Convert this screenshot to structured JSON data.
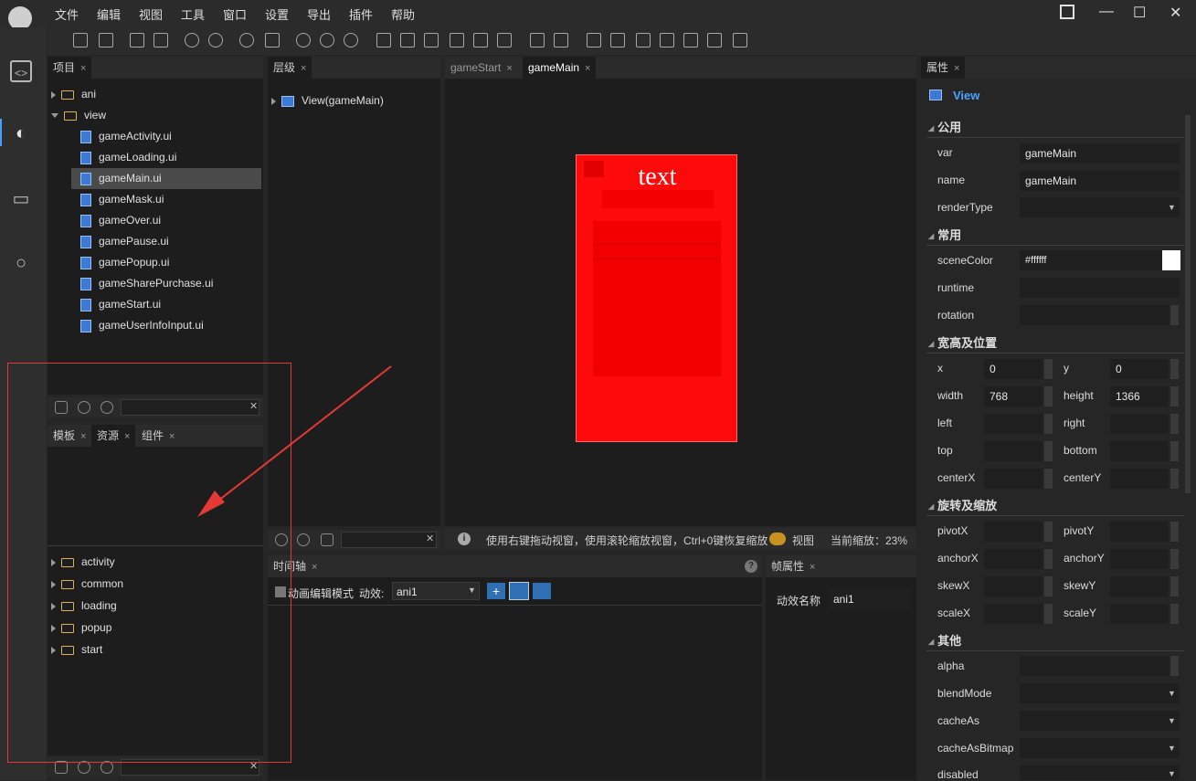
{
  "menu": [
    "文件",
    "编辑",
    "视图",
    "工具",
    "窗口",
    "设置",
    "导出",
    "插件",
    "帮助"
  ],
  "window_controls": {
    "gift": "gift-icon",
    "minimize": "—",
    "maximize": "☐",
    "close": "✕"
  },
  "project_panel": {
    "tab": "项目",
    "tree": [
      {
        "label": "ani",
        "type": "folder",
        "expanded": false
      },
      {
        "label": "view",
        "type": "folder",
        "expanded": true
      },
      {
        "label": "gameActivity.ui",
        "type": "file"
      },
      {
        "label": "gameLoading.ui",
        "type": "file"
      },
      {
        "label": "gameMain.ui",
        "type": "file",
        "selected": true
      },
      {
        "label": "gameMask.ui",
        "type": "file"
      },
      {
        "label": "gameOver.ui",
        "type": "file"
      },
      {
        "label": "gamePause.ui",
        "type": "file"
      },
      {
        "label": "gamePopup.ui",
        "type": "file"
      },
      {
        "label": "gameSharePurchase.ui",
        "type": "file"
      },
      {
        "label": "gameStart.ui",
        "type": "file"
      },
      {
        "label": "gameUserInfoInput.ui",
        "type": "file"
      }
    ]
  },
  "resource_panel": {
    "tabs": [
      "模板",
      "资源",
      "组件"
    ],
    "folders": [
      "activity",
      "common",
      "loading",
      "popup",
      "start"
    ]
  },
  "hierarchy_panel": {
    "tab": "层级",
    "root": "View(gameMain)"
  },
  "editor": {
    "tabs": [
      "gameStart",
      "gameMain"
    ],
    "active_tab": "gameMain",
    "canvas_text": "text",
    "canvas_color": "#ff0000",
    "status_hint": "使用右键拖动视窗，使用滚轮缩放视窗，Ctrl+0键恢复缩放",
    "view_label": "视图",
    "zoom_label": "当前缩放：23%"
  },
  "timeline": {
    "tab": "时间轴",
    "mode_label": "动画编辑模式",
    "anim_label": "动效:",
    "anim_value": "ani1"
  },
  "frame_props": {
    "tab": "帧属性",
    "name_label": "动效名称",
    "name_value": "ani1"
  },
  "properties": {
    "tab": "属性",
    "component": "View",
    "sections": {
      "common": "公用",
      "usual": "常用",
      "size_pos": "宽高及位置",
      "rot_scale": "旋转及缩放",
      "other": "其他"
    },
    "var_label": "var",
    "var_value": "gameMain",
    "name_label": "name",
    "name_value": "gameMain",
    "renderType_label": "renderType",
    "sceneColor_label": "sceneColor",
    "sceneColor_value": "#ffffff",
    "runtime_label": "runtime",
    "rotation_label": "rotation",
    "x_label": "x",
    "x_value": "0",
    "y_label": "y",
    "y_value": "0",
    "width_label": "width",
    "width_value": "768",
    "height_label": "height",
    "height_value": "1366",
    "left_label": "left",
    "right_label": "right",
    "top_label": "top",
    "bottom_label": "bottom",
    "centerX_label": "centerX",
    "centerY_label": "centerY",
    "pivotX_label": "pivotX",
    "pivotY_label": "pivotY",
    "anchorX_label": "anchorX",
    "anchorY_label": "anchorY",
    "skewX_label": "skewX",
    "skewY_label": "skewY",
    "scaleX_label": "scaleX",
    "scaleY_label": "scaleY",
    "alpha_label": "alpha",
    "blendMode_label": "blendMode",
    "cacheAs_label": "cacheAs",
    "cacheAsBitmap_label": "cacheAsBitmap",
    "disabled_label": "disabled"
  },
  "annotation_color": "#e53935"
}
